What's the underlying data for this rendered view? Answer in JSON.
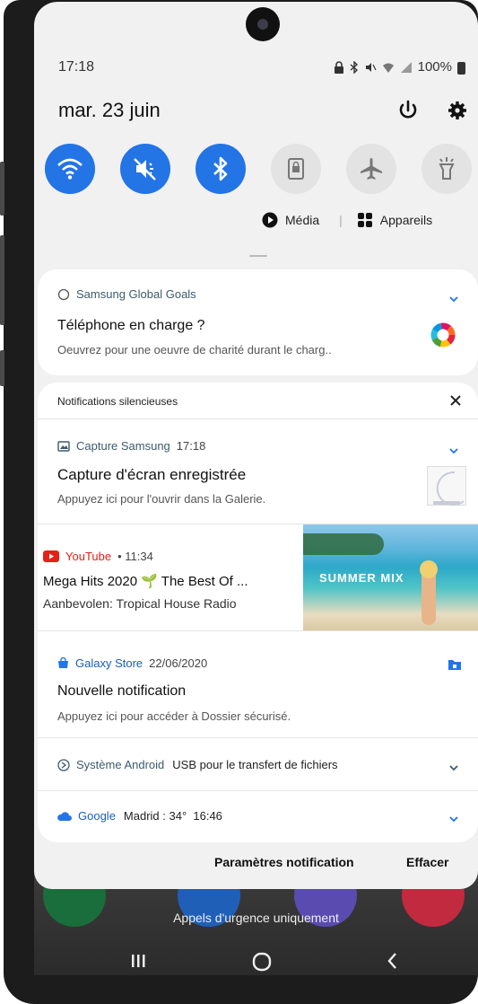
{
  "status_bar": {
    "time": "17:18",
    "battery_percent": "100%"
  },
  "header": {
    "date": "mar. 23 juin"
  },
  "quick_panel": {
    "toggles": [
      {
        "name": "wifi",
        "on": true
      },
      {
        "name": "mute",
        "on": true
      },
      {
        "name": "bluetooth",
        "on": true
      },
      {
        "name": "portrait-lock",
        "on": false
      },
      {
        "name": "airplane",
        "on": false
      },
      {
        "name": "flashlight",
        "on": false
      }
    ],
    "media_label": "Média",
    "devices_label": "Appareils"
  },
  "notifications": {
    "goals": {
      "app": "Samsung Global Goals",
      "title": "Téléphone en charge ?",
      "body": "Oeuvrez pour une oeuvre de charité durant le charg.."
    },
    "silent_header": "Notifications silencieuses",
    "capture": {
      "app": "Capture Samsung",
      "time": "17:18",
      "title": "Capture d'écran enregistrée",
      "body": "Appuyez ici pour l'ouvrir dans la Galerie."
    },
    "youtube": {
      "app": "YouTube",
      "time": "• 11:34",
      "title": "Mega Hits 2020 🌱 The Best Of ...",
      "body": "Aanbevolen: Tropical House Radio",
      "thumb_text": "SUMMER MIX"
    },
    "galaxy_store": {
      "app": "Galaxy Store",
      "time": "22/06/2020",
      "title": "Nouvelle notification",
      "body": "Appuyez ici pour accéder à Dossier sécurisé."
    },
    "android": {
      "app": "Système Android",
      "text": "USB pour le transfert de fichiers"
    },
    "google": {
      "app": "Google",
      "text": "Madrid : 34°  16:46"
    }
  },
  "footer": {
    "settings": "Paramètres notification",
    "clear": "Effacer"
  },
  "lockscreen": {
    "emergency": "Appels d'urgence uniquement"
  },
  "colors": {
    "accent": "#2374e5",
    "youtube": "#e62117"
  }
}
